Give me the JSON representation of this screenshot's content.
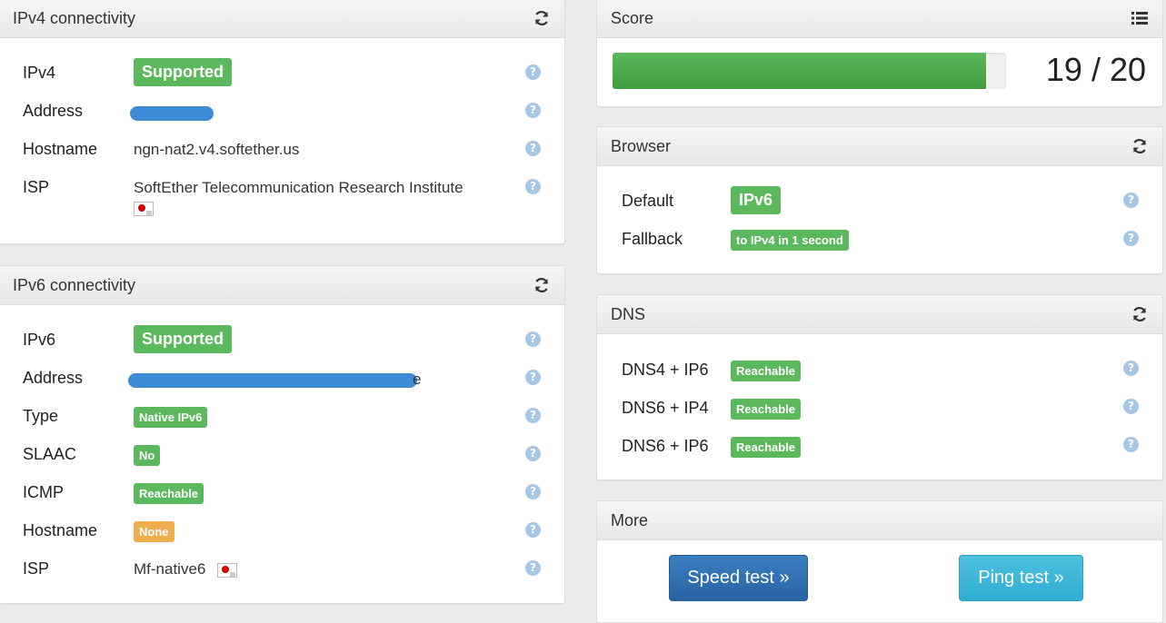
{
  "ipv4": {
    "title": "IPv4 connectivity",
    "rows": {
      "ipv4": {
        "label": "IPv4",
        "badge": "Supported"
      },
      "address": {
        "label": "Address"
      },
      "hostname": {
        "label": "Hostname",
        "value": "ngn-nat2.v4.softether.us"
      },
      "isp": {
        "label": "ISP",
        "value": "SoftEther Telecommunication Research Institute"
      }
    }
  },
  "ipv6": {
    "title": "IPv6 connectivity",
    "rows": {
      "ipv6": {
        "label": "IPv6",
        "badge": "Supported"
      },
      "address": {
        "label": "Address",
        "trailing": "e"
      },
      "type": {
        "label": "Type",
        "badge": "Native IPv6"
      },
      "slaac": {
        "label": "SLAAC",
        "badge": "No"
      },
      "icmp": {
        "label": "ICMP",
        "badge": "Reachable"
      },
      "hostname": {
        "label": "Hostname",
        "badge": "None"
      },
      "isp": {
        "label": "ISP",
        "value": "Mf-native6"
      }
    }
  },
  "score": {
    "title": "Score",
    "text": "19 / 20",
    "progress_fraction": 0.95
  },
  "browser": {
    "title": "Browser",
    "rows": {
      "default": {
        "label": "Default",
        "badge": "IPv6"
      },
      "fallback": {
        "label": "Fallback",
        "badge": "to IPv4 in 1 second"
      }
    }
  },
  "dns": {
    "title": "DNS",
    "rows": {
      "dns4ip6": {
        "label": "DNS4 + IP6",
        "badge": "Reachable"
      },
      "dns6ip4": {
        "label": "DNS6 + IP4",
        "badge": "Reachable"
      },
      "dns6ip6": {
        "label": "DNS6 + IP6",
        "badge": "Reachable"
      }
    }
  },
  "more": {
    "title": "More",
    "speed_test": "Speed test »",
    "ping_test": "Ping test »"
  },
  "help_glyph": "?",
  "colors": {
    "success": "#5cb85c",
    "warning": "#f0ad4e",
    "primary": "#2a63a3",
    "info": "#30acd3",
    "redaction": "#3d8bd6"
  }
}
